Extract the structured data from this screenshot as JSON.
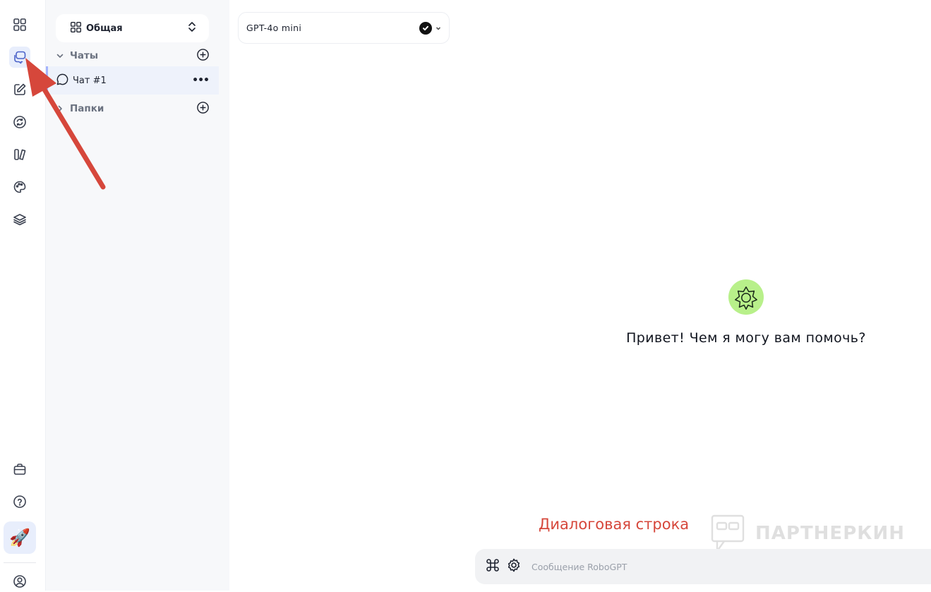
{
  "rail": {
    "items": [
      {
        "icon": "apps-grid-icon"
      },
      {
        "icon": "chats-icon",
        "active": true
      },
      {
        "icon": "edit-icon"
      },
      {
        "icon": "sync-icon"
      },
      {
        "icon": "library-icon"
      },
      {
        "icon": "palette-icon"
      },
      {
        "icon": "layers-icon"
      }
    ],
    "bottom_items": [
      {
        "icon": "briefcase-icon"
      },
      {
        "icon": "help-icon"
      },
      {
        "icon": "rocket-icon",
        "emoji": "🚀"
      },
      {
        "icon": "profile-icon"
      }
    ]
  },
  "sidebar": {
    "workspace_label": "Общая",
    "chats_section": "Чаты",
    "chat_items": [
      {
        "label": "Чат #1"
      }
    ],
    "folders_section": "Папки",
    "more_label": "•••"
  },
  "main": {
    "model_name": "GPT-4o mini",
    "greeting": "Привет! Чем я могу вам помочь?",
    "annotation": "Диалоговая строка",
    "watermark": "ПАРТНЕРКИН",
    "composer_placeholder": "Сообщение RoboGPT"
  },
  "colors": {
    "accent": "#4a62c9",
    "annotation_red": "#d6473b",
    "logo_green": "#b8f08a"
  }
}
